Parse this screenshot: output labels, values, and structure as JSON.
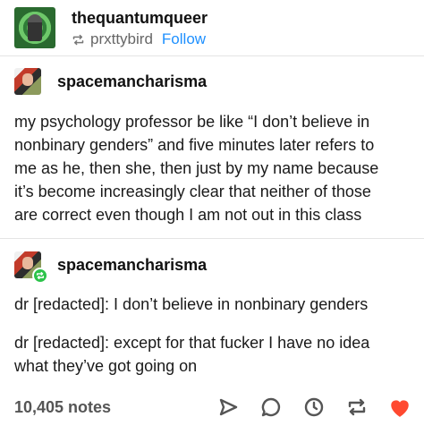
{
  "header": {
    "blog_name": "thequantumqueer",
    "reblogged_from": "prxttybird",
    "follow_label": "Follow",
    "avatar_icon": "robot-avatar-icon"
  },
  "posts": [
    {
      "author": "spacemancharisma",
      "lines": [
        "my psychology professor be like “I don’t believe in",
        "nonbinary genders” and five minutes later refers to",
        "me as he, then she, then just by my name because",
        "it’s become increasingly clear that neither of those",
        "are correct even though I am not out in this class"
      ]
    },
    {
      "author": "spacemancharisma",
      "paragraphs": [
        [
          "dr [redacted]: I don’t believe in nonbinary genders"
        ],
        [
          "dr [redacted]: except for that fucker I have no idea",
          "what they’ve got going on"
        ]
      ]
    }
  ],
  "footer": {
    "notes": "10,405 notes",
    "icons": [
      "share-icon",
      "reply-icon",
      "history-icon",
      "reblog-icon",
      "like-heart-icon"
    ],
    "heart_color": "#ff4930",
    "icon_color": "#555555"
  },
  "colors": {
    "follow": "#1e90ff",
    "reblog_badge": "#2cc34a"
  }
}
